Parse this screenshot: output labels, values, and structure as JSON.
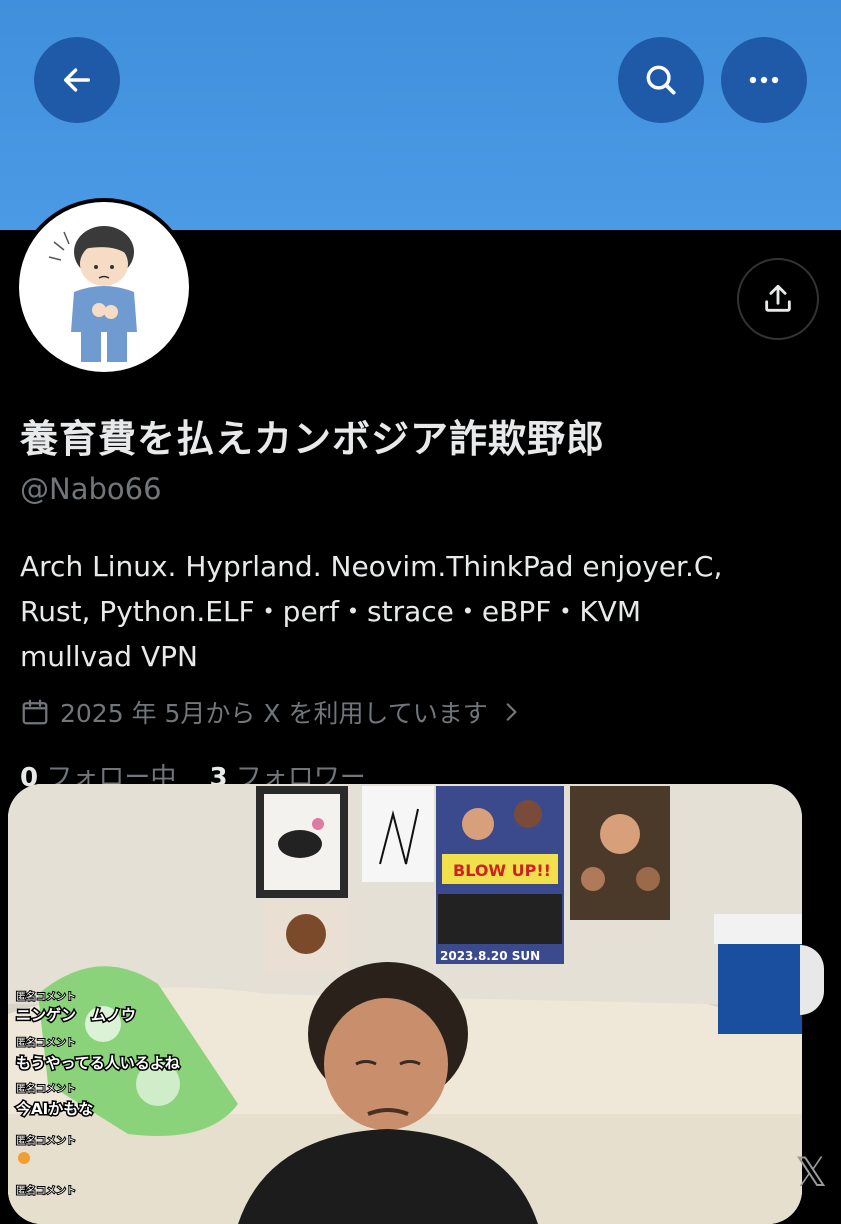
{
  "header": {
    "back_icon": "arrow-left-icon",
    "search_icon": "search-icon",
    "more_icon": "more-horizontal-icon",
    "banner_color": "#4a9ae6",
    "button_color": "#1f5aa8"
  },
  "profile": {
    "display_name": "養育費を払えカンボジア詐欺野郎",
    "handle": "@Nabo66",
    "bio_lines": [
      "Arch Linux. Hyprland. Neovim.ThinkPad enjoyer.C,",
      "Rust, Python.ELF・perf・strace・eBPF・KVM",
      "mullvad VPN"
    ],
    "joined_text": "2025 年 5月から X を利用しています",
    "following_count": "0",
    "following_label": "フォロー中",
    "followers_count": "3",
    "followers_label": "フォロワー"
  },
  "video_overlay": {
    "poster_date": "2023.8.20 SUN",
    "poster_title": "BLOW UP!!",
    "comments": [
      {
        "label": "匿名コメント",
        "text": "ニンゲン　ムノウ"
      },
      {
        "label": "匿名コメント",
        "text": "もうやってる人いるよね"
      },
      {
        "label": "匿名コメント",
        "text": "今AIかもな"
      },
      {
        "label": "匿名コメント",
        "text": ""
      },
      {
        "label": "匿名コメント",
        "text": ""
      }
    ]
  },
  "colors": {
    "text_primary": "#e7e9ea",
    "text_secondary": "#71767b",
    "background": "#000000"
  }
}
